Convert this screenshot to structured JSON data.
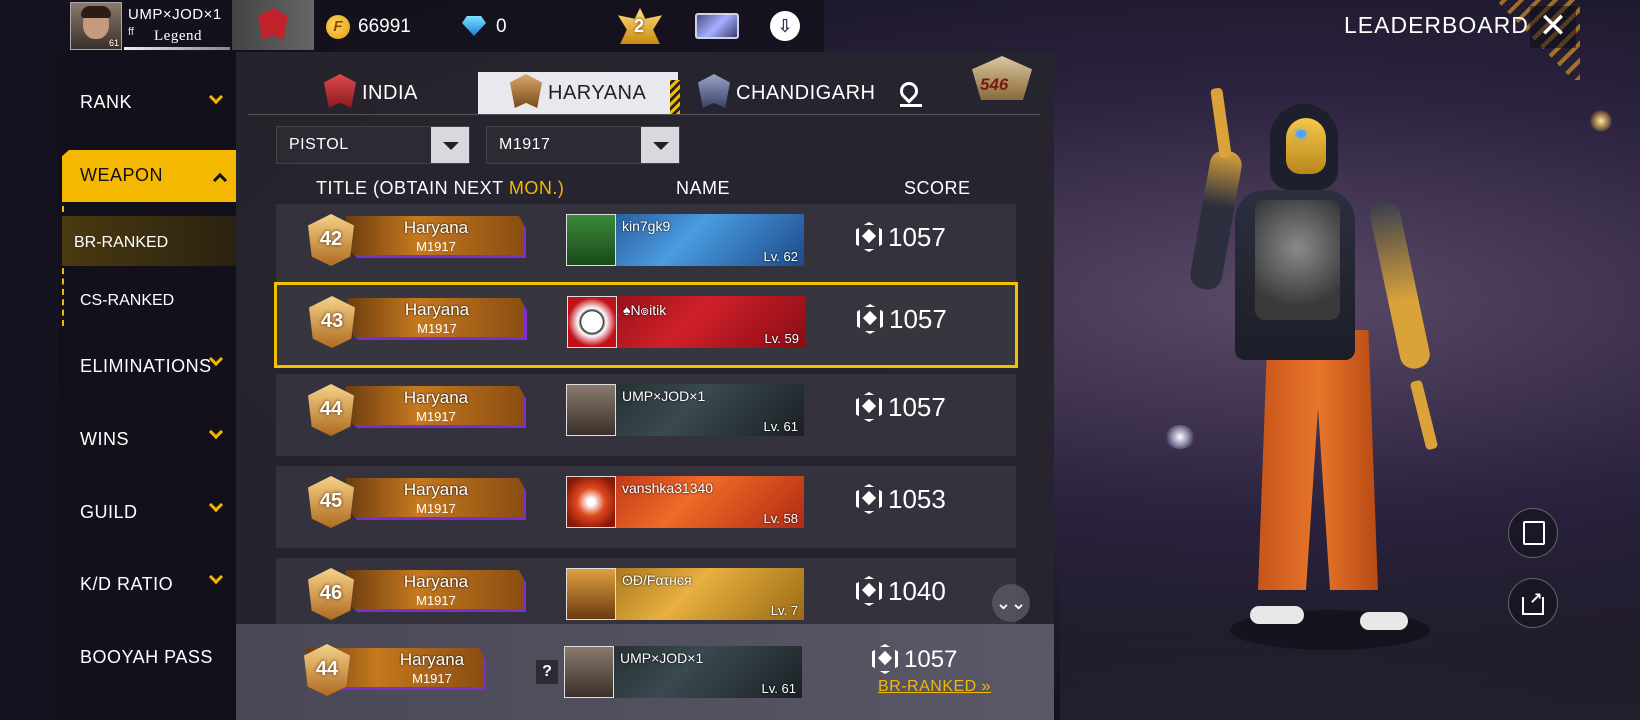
{
  "player": {
    "name": "UMP×JOD×1",
    "ff_tag": "ff",
    "rank_title": "Legend",
    "avatar_level": "61"
  },
  "currency": {
    "coins": "66991",
    "diamonds": "0",
    "rank_badge_number": "2"
  },
  "header": {
    "title": "LEADERBOARD"
  },
  "sidebar": {
    "items": [
      {
        "label": "RANK"
      },
      {
        "label": "WEAPON"
      },
      {
        "label": "BR-RANKED"
      },
      {
        "label": "CS-RANKED"
      },
      {
        "label": "ELIMINATIONS"
      },
      {
        "label": "WINS"
      },
      {
        "label": "GUILD"
      },
      {
        "label": "K/D RATIO"
      },
      {
        "label": "BOOYAH PASS"
      }
    ]
  },
  "tabs": [
    {
      "label": "INDIA"
    },
    {
      "label": "HARYANA"
    },
    {
      "label": "CHANDIGARH"
    }
  ],
  "season_badge": "546",
  "filters": {
    "category": "PISTOL",
    "weapon": "M1917"
  },
  "columns": {
    "title": "TITLE (OBTAIN NEXT ",
    "title_highlight": "MON.)",
    "name": "NAME",
    "score": "SCORE"
  },
  "rows": [
    {
      "rank": "42",
      "title_line1": "Haryana",
      "title_line2": "M1917",
      "name": "kin7gk9",
      "level": "Lv. 62",
      "score": "1057",
      "card_color": "#2f74c0"
    },
    {
      "rank": "43",
      "title_line1": "Haryana",
      "title_line2": "M1917",
      "name": "♠N๏itik",
      "level": "Lv. 59",
      "score": "1057",
      "card_color": "#b8141c"
    },
    {
      "rank": "44",
      "title_line1": "Haryana",
      "title_line2": "M1917",
      "name": "UMP×JOD×1",
      "level": "Lv. 61",
      "score": "1057",
      "card_color": "#2a3338"
    },
    {
      "rank": "45",
      "title_line1": "Haryana",
      "title_line2": "M1917",
      "name": "vanshka31340",
      "level": "Lv. 58",
      "score": "1053",
      "card_color": "#d8401c"
    },
    {
      "rank": "46",
      "title_line1": "Haryana",
      "title_line2": "M1917",
      "name": "ʘĐ/Fατнєя",
      "level": "Lv. 7",
      "score": "1040",
      "card_color": "#c8901e"
    }
  ],
  "my_row": {
    "rank": "44",
    "title_line1": "Haryana",
    "title_line2": "M1917",
    "name": "UMP×JOD×1",
    "level": "Lv. 61",
    "score": "1057",
    "help": "?",
    "mode_link": "BR-RANKED »"
  },
  "colors": {
    "accent": "#f5b800",
    "highlight_border": "#f5c000",
    "title_plate_border": "#7b2fd0"
  }
}
